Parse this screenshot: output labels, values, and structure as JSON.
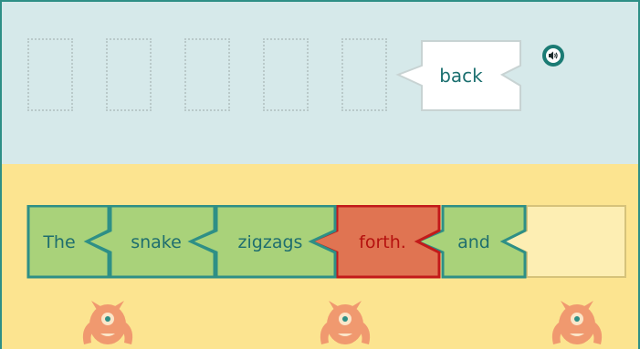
{
  "answer_area": {
    "empty_slots": 5,
    "word_card": "back"
  },
  "audio_button": {
    "icon": "speaker-icon"
  },
  "sentence_bar": {
    "words": [
      {
        "text": "The",
        "state": "placed"
      },
      {
        "text": "snake",
        "state": "placed"
      },
      {
        "text": "zigzags",
        "state": "placed"
      },
      {
        "text": "forth.",
        "state": "selected"
      },
      {
        "text": "and",
        "state": "placed"
      },
      {
        "text": "",
        "state": "empty"
      }
    ]
  },
  "colors": {
    "top_background": "#d6e9ea",
    "bottom_background": "#fce490",
    "word_fill": "#a9d27a",
    "word_border": "#2e8f86",
    "selected_fill": "#e07452",
    "selected_border": "#c21a1a",
    "selected_text": "#b5110f",
    "text": "#1f6e6e",
    "monster": "#f0996f"
  },
  "decorations": {
    "monsters": 3,
    "icon": "monster-icon"
  }
}
